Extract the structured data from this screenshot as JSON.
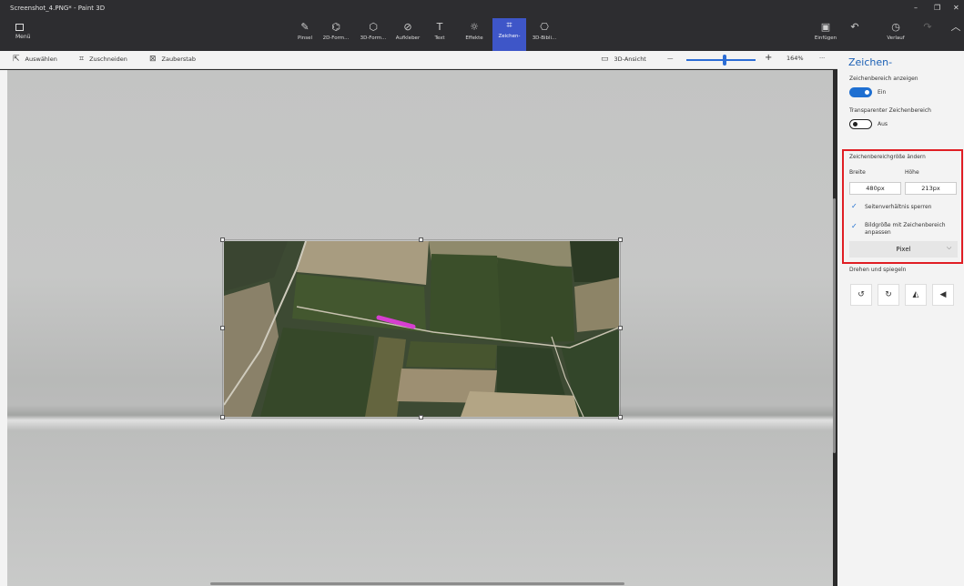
{
  "window": {
    "title": "Screenshot_4.PNG* - Paint 3D",
    "controls": [
      "–",
      "❐",
      "✕"
    ]
  },
  "ribbon": {
    "menu_label": "Menü",
    "tools": [
      {
        "label": "Pinsel",
        "icon": "brush-icon",
        "glyph": "✎"
      },
      {
        "label": "2D-Form...",
        "icon": "2d-shapes-icon",
        "glyph": "⌬"
      },
      {
        "label": "3D-Form...",
        "icon": "3d-shapes-icon",
        "glyph": "⬡"
      },
      {
        "label": "Aufkleber",
        "icon": "sticker-icon",
        "glyph": "⊘"
      },
      {
        "label": "Text",
        "icon": "text-icon",
        "glyph": "T"
      },
      {
        "label": "Effekte",
        "icon": "effects-icon",
        "glyph": "☼"
      },
      {
        "label": "Zeichen-",
        "icon": "canvas-icon",
        "glyph": "⌗"
      },
      {
        "label": "3D-Bibli...",
        "icon": "3d-library-icon",
        "glyph": "⎔"
      }
    ],
    "paste_label": "Einfügen",
    "undo_glyph": "↶",
    "history_label": "Verlauf",
    "redo_glyph": "↷",
    "collapse_glyph": "︿"
  },
  "toolbar": {
    "select_label": "Auswählen",
    "crop_label": "Zuschneiden",
    "magic_label": "Zauberstab",
    "view3d_label": "3D-Ansicht",
    "zoom_minus": "—",
    "zoom_plus": "+",
    "zoom_value": "164%",
    "more": "···",
    "zoom_level": 0.55
  },
  "panel": {
    "title": "Zeichen-",
    "show_canvas_label": "Zeichenbereich anzeigen",
    "show_canvas_state": "Ein",
    "transparent_label": "Transparenter Zeichenbereich",
    "transparent_state": "Aus",
    "resize_title": "Zeichenbereichgröße ändern",
    "width_label": "Breite",
    "height_label": "Höhe",
    "width_value": "480px",
    "height_value": "213px",
    "lock_aspect_label": "Seitenverhältnis sperren",
    "resize_image_label": "Bildgröße mit Zeichenbereich anpassen",
    "unit_value": "Pixel",
    "rotate_title": "Drehen und spiegeln",
    "rotate_buttons": [
      {
        "icon": "rotate-left-icon",
        "glyph": "↺"
      },
      {
        "icon": "rotate-right-icon",
        "glyph": "↻"
      },
      {
        "icon": "flip-horizontal-icon",
        "glyph": "◭"
      },
      {
        "icon": "flip-vertical-icon",
        "glyph": "◀"
      }
    ]
  },
  "colors": {
    "accent": "#1e6fd1",
    "highlight": "#e01e24",
    "brush_stroke": "#d63fd0"
  }
}
